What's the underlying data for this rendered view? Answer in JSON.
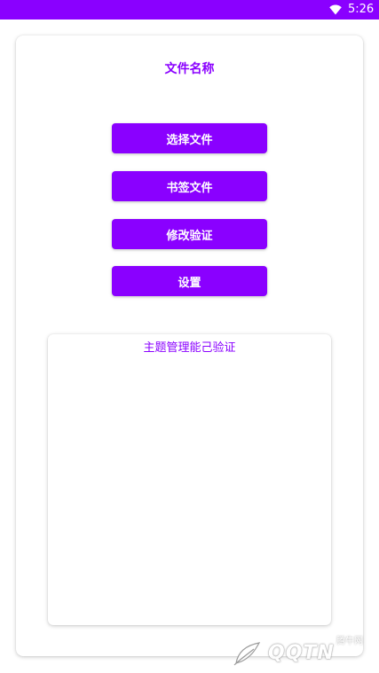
{
  "status_bar": {
    "time": "5:26",
    "wifi_icon": "wifi-icon",
    "background_color": "#8a00ff"
  },
  "card": {
    "title": "文件名称"
  },
  "buttons": [
    {
      "label": "选择文件"
    },
    {
      "label": "书签文件"
    },
    {
      "label": "修改验证"
    },
    {
      "label": "设置"
    }
  ],
  "info_panel": {
    "text": "主题管理能己验证"
  },
  "watermark": {
    "text": "QQTN",
    "subtext": "腾牛网"
  },
  "colors": {
    "accent": "#8a00ff",
    "button_text": "#ffffff",
    "background": "#ffffff"
  }
}
